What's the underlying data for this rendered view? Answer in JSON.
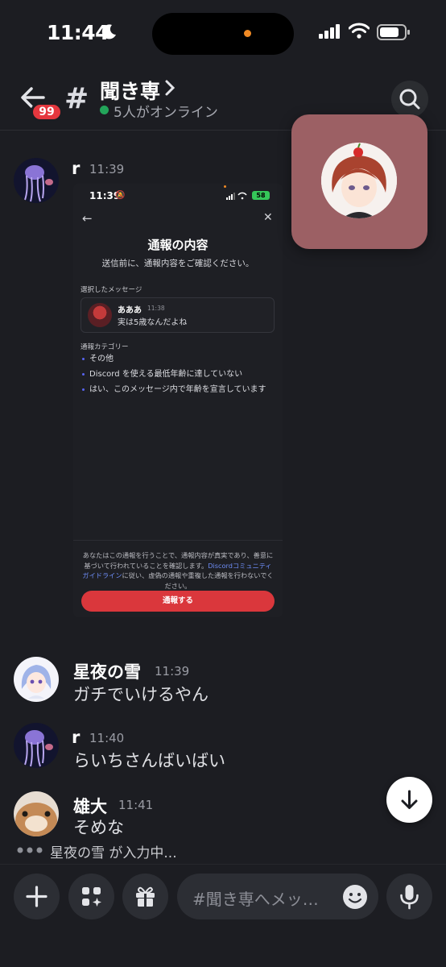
{
  "status_bar": {
    "time": "11:44",
    "icons": [
      "moon-icon",
      "cellular-signal-icon",
      "wifi-icon",
      "battery-icon"
    ]
  },
  "header": {
    "unread_badge": "99",
    "channel_name": "聞き専",
    "online_status": "5人がオンライン",
    "icons": [
      "back-arrow-icon",
      "hash-icon",
      "chevron-right-icon",
      "search-icon"
    ]
  },
  "messages": [
    {
      "author": "r",
      "time": "11:39",
      "attachment": {
        "status_time": "11:39",
        "battery": "58",
        "title": "通報の内容",
        "subtitle": "送信前に、通報内容をご確認ください。",
        "selected_label": "選択したメッセージ",
        "quoted_author": "あああ",
        "quoted_time": "11:38",
        "quoted_text": "実は5歳なんだよね",
        "category_label": "通報カテゴリー",
        "categories": [
          "その他",
          "Discord を使える最低年齢に達していない",
          "はい、このメッセージ内で年齢を宣言しています"
        ],
        "disclaimer_before_link": "あなたはこの通報を行うことで、通報内容が真実であり、善意に基づいて行われていることを確認します。",
        "disclaimer_link": "Discordコミュニティガイドライン",
        "disclaimer_after_link": "に従い、虚偽の通報や重複した通報を行わないでください。",
        "report_button": "通報する"
      }
    },
    {
      "author": "星夜の雪",
      "time": "11:39",
      "text": "ガチでいけるやん"
    },
    {
      "author": "r",
      "time": "11:40",
      "text": "らいちさんばいばい"
    },
    {
      "author": "雄大",
      "time": "11:41",
      "text": "そめな"
    }
  ],
  "typing_indicator": "星夜の雪 が入力中...",
  "composer": {
    "placeholder": "#聞き専へメッ…",
    "icons": [
      "plus-icon",
      "apps-icon",
      "gift-icon",
      "emoji-icon",
      "microphone-icon"
    ]
  },
  "colors": {
    "background": "#1c1d22",
    "badge": "#e5373e",
    "online": "#23a55a",
    "report_button": "#da373c",
    "float_card": "#9c6064",
    "link": "#6d8cf5"
  }
}
